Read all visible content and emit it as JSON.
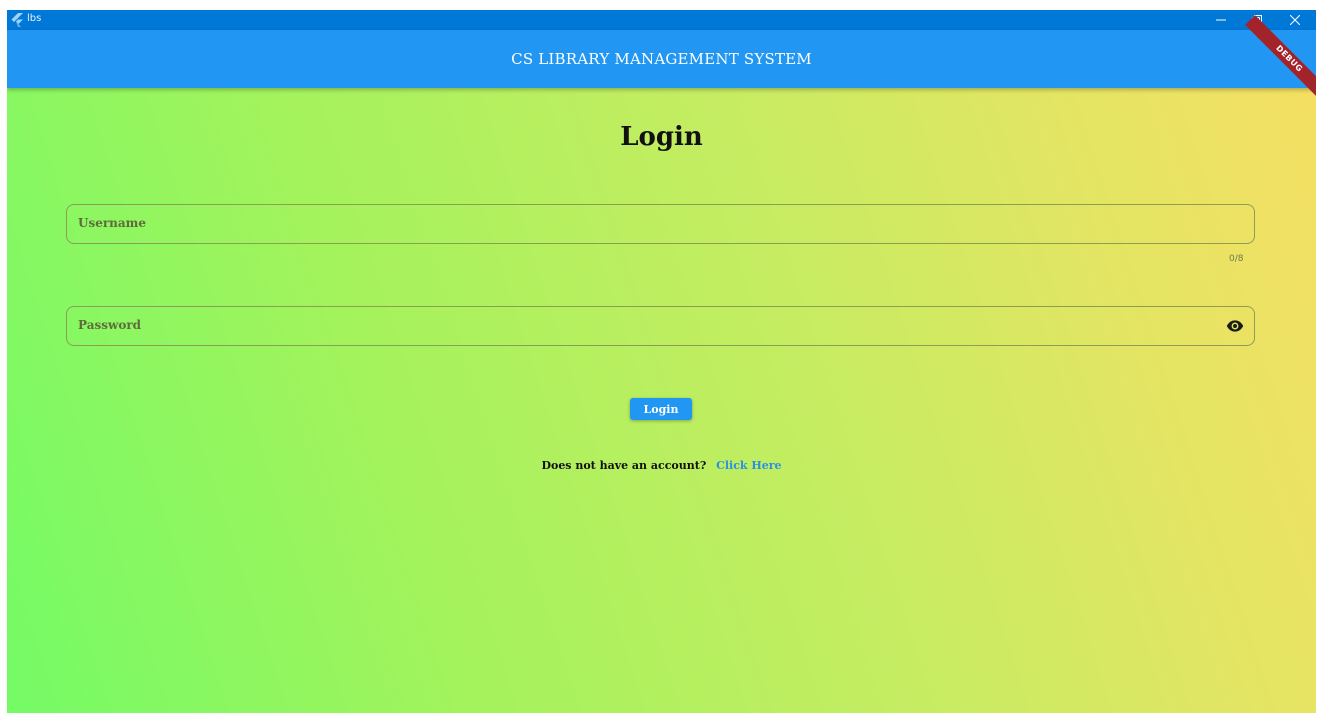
{
  "window": {
    "title": "lbs",
    "controls": {
      "minimize_icon": "minimize-icon",
      "restore_icon": "restore-icon",
      "close_icon": "close-icon"
    }
  },
  "appbar": {
    "title": "CS LIBRARY MANAGEMENT SYSTEM",
    "debug_banner": "DEBUG",
    "color": "#2196f3"
  },
  "login": {
    "heading": "Login",
    "username": {
      "placeholder": "Username",
      "value": "",
      "counter": "0/8"
    },
    "password": {
      "placeholder": "Password",
      "value": "",
      "visibility_icon": "eye-icon"
    },
    "button_label": "Login",
    "signup_prompt": "Does not have an account?",
    "signup_link": "Click Here"
  },
  "colors": {
    "titlebar": "#0078d7",
    "accent": "#2196f3",
    "gradient_start": "#74fb66",
    "gradient_end": "#f4df63"
  }
}
